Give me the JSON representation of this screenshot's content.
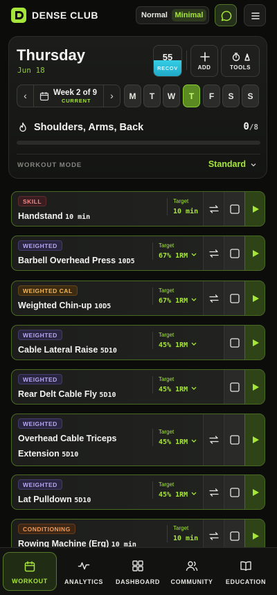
{
  "app": {
    "brand": "DENSE CLUB"
  },
  "view_mode": {
    "normal_label": "Normal",
    "minimal_label": "Minimal",
    "selected": "Minimal"
  },
  "day": {
    "name": "Thursday",
    "date": "Jun 18"
  },
  "recovery": {
    "value": "55",
    "label": "RECOV"
  },
  "tools": {
    "add_label": "ADD",
    "tools_label": "TOOLS"
  },
  "week": {
    "label": "Week 2 of 9",
    "status": "CURRENT"
  },
  "days": [
    {
      "letter": "M"
    },
    {
      "letter": "T"
    },
    {
      "letter": "W"
    },
    {
      "letter": "T",
      "active": true
    },
    {
      "letter": "F"
    },
    {
      "letter": "S"
    },
    {
      "letter": "S"
    }
  ],
  "session": {
    "focus": "Shoulders, Arms, Back",
    "completed": "0",
    "total": "/8",
    "progress": 0
  },
  "workout_mode": {
    "label": "WORKOUT MODE",
    "value": "Standard"
  },
  "exercises": [
    {
      "tag": "SKILL",
      "name": "Handstand",
      "detail": "10 min",
      "target_label": "Target",
      "target_value": "10 min"
    },
    {
      "tag": "WEIGHTED",
      "name": "Barbell Overhead Press",
      "detail": "10D5",
      "target_label": "Target",
      "target_value": "67% 1RM"
    },
    {
      "tag": "WEIGHTED CAL",
      "name": "Weighted Chin-up",
      "detail": "10D5",
      "target_label": "Target",
      "target_value": "67% 1RM"
    },
    {
      "tag": "WEIGHTED",
      "name": "Cable Lateral Raise",
      "detail": "5D10",
      "target_label": "Target",
      "target_value": "45% 1RM"
    },
    {
      "tag": "WEIGHTED",
      "name": "Rear Delt Cable Fly",
      "detail": "5D10",
      "target_label": "Target",
      "target_value": "45% 1RM"
    },
    {
      "tag": "WEIGHTED",
      "name_line1": "Overhead Cable Triceps",
      "name_line2": "Extension",
      "detail": "5D10",
      "target_label": "Target",
      "target_value": "45% 1RM"
    },
    {
      "tag": "WEIGHTED",
      "name": "Lat Pulldown",
      "detail": "5D10",
      "target_label": "Target",
      "target_value": "45% 1RM"
    },
    {
      "tag": "CONDITIONING",
      "name": "Rowing Machine (Erg)",
      "detail": "10 min",
      "target_label": "Target",
      "target_value": "10 min"
    }
  ],
  "nav": [
    {
      "label": "WORKOUT",
      "icon": "calendar-icon",
      "active": true
    },
    {
      "label": "ANALYTICS",
      "icon": "pulse-icon"
    },
    {
      "label": "DASHBOARD",
      "icon": "grid-icon"
    },
    {
      "label": "COMMUNITY",
      "icon": "users-icon"
    },
    {
      "label": "EDUCATION",
      "icon": "book-icon"
    }
  ],
  "colors": {
    "accent": "#a6e63a",
    "background": "#0c0d0b",
    "recovery": "#2fc3de"
  }
}
